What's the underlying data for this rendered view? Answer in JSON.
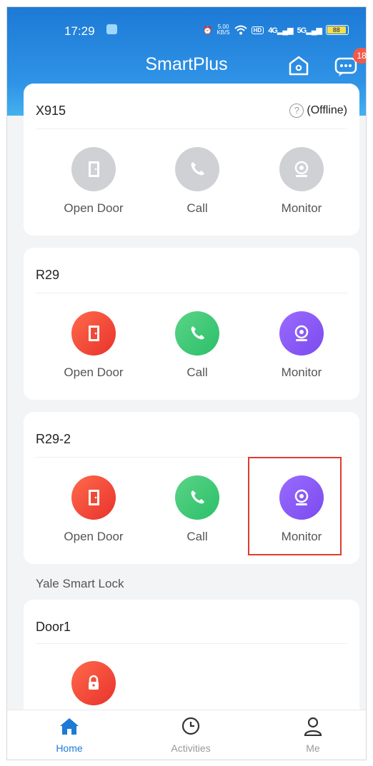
{
  "status_bar": {
    "time": "17:29",
    "net_speed_top": "5.00",
    "net_speed_bottom": "KB/S",
    "hd": "HD",
    "sig1": "4G",
    "sig2": "5G",
    "battery": "88"
  },
  "header": {
    "title": "SmartPlus",
    "notification_count": "18"
  },
  "cards": [
    {
      "title": "X915",
      "status": "(Offline)",
      "actions": [
        "Open Door",
        "Call",
        "Monitor"
      ]
    },
    {
      "title": "R29",
      "actions": [
        "Open Door",
        "Call",
        "Monitor"
      ]
    },
    {
      "title": "R29-2",
      "actions": [
        "Open Door",
        "Call",
        "Monitor"
      ]
    }
  ],
  "section_label": "Yale Smart Lock",
  "lock_card": {
    "title": "Door1"
  },
  "tabbar": {
    "tabs": [
      "Home",
      "Activities",
      "Me"
    ],
    "active": "Home"
  },
  "colors": {
    "header": "#1d7ad6",
    "open_door": "#e8322c",
    "call": "#2bbf6a",
    "monitor": "#7b4bee",
    "offline_grey": "#cfd1d4",
    "highlight_border": "#e03b2e"
  }
}
